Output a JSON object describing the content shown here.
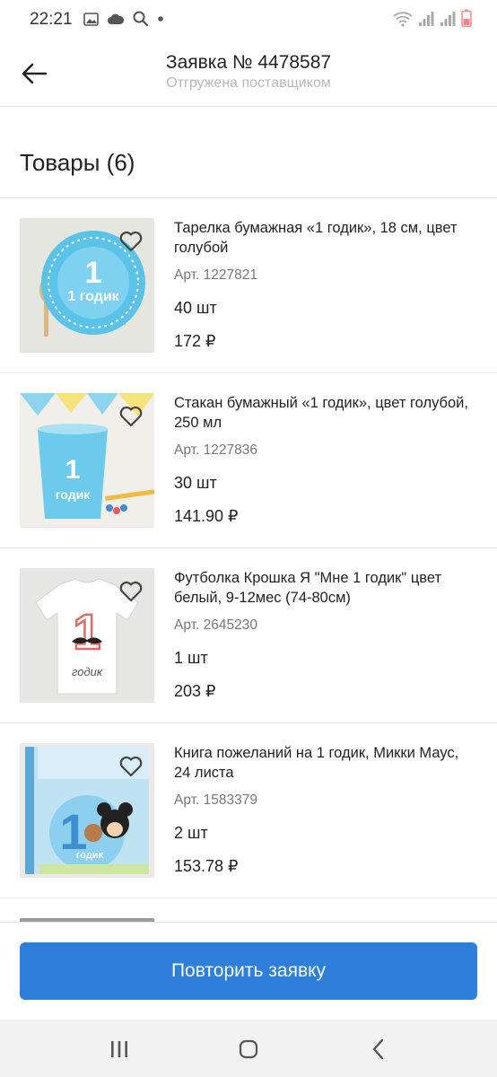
{
  "status_bar": {
    "time": "22:21",
    "icons_left": [
      "image-icon",
      "cloud-icon",
      "search-icon",
      "dot-icon"
    ],
    "icons_right": [
      "wifi-icon",
      "signal-icon",
      "signal-icon",
      "battery-icon"
    ]
  },
  "header": {
    "title": "Заявка № 4478587",
    "subtitle": "Отгружена поставщиком"
  },
  "section": {
    "title": "Товары (6)"
  },
  "items": [
    {
      "name": "Тарелка бумажная «1 годик», 18 см, цвет голубой",
      "art": "Арт. 1227821",
      "qty": "40 шт",
      "price": "172 ₽",
      "thumb_text": "1 годик"
    },
    {
      "name": "Стакан бумажный «1 годик», цвет голубой, 250 мл",
      "art": "Арт. 1227836",
      "qty": "30 шт",
      "price": "141.90 ₽",
      "thumb_text": "годик"
    },
    {
      "name": "Футболка Крошка Я \"Мне 1 годик\" цвет белый, 9-12мес (74-80см)",
      "art": "Арт. 2645230",
      "qty": "1 шт",
      "price": "203 ₽",
      "thumb_text": "годик"
    },
    {
      "name": "Книга пожеланий на 1 годик, Микки Маус, 24 листа",
      "art": "Арт. 1583379",
      "qty": "2 шт",
      "price": "153.78 ₽",
      "thumb_text": "годик"
    }
  ],
  "footer": {
    "repeat_button": "Повторить заявку"
  },
  "colors": {
    "accent": "#2e7fd9",
    "subtitle": "#b8b8b8",
    "divider": "#e2e2e2"
  },
  "nav_bar": {
    "icons": [
      "recent-apps-icon",
      "home-icon",
      "back-nav-icon"
    ]
  }
}
